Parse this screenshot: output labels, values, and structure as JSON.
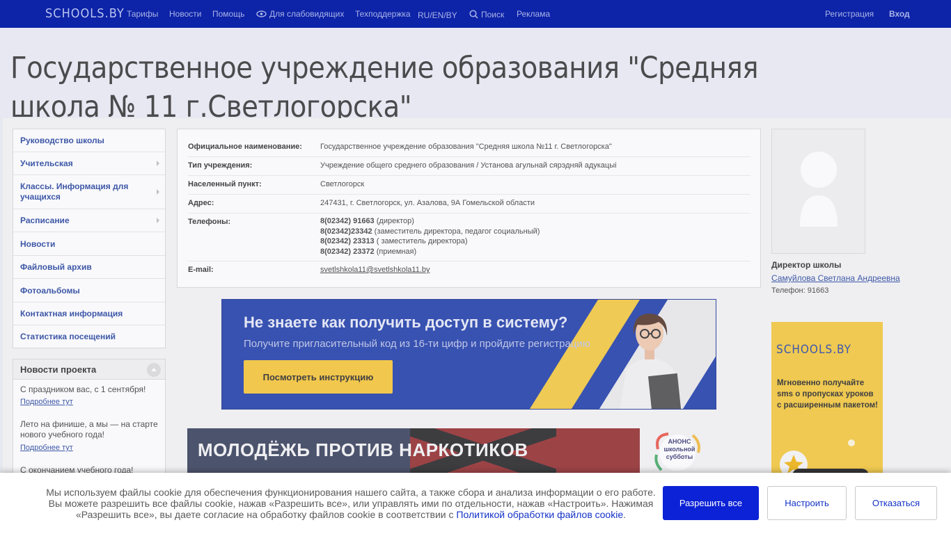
{
  "topnav": {
    "logo": "SCHOOLS.BY",
    "tariffs": "Тарифы",
    "news": "Новости",
    "help": "Помощь",
    "low_vision": "Для слабовидящих",
    "support": "Техподдержка",
    "lang": "RU/EN/BY",
    "search": "Поиск",
    "ads": "Реклама",
    "register": "Регистрация",
    "login": "Вход"
  },
  "header": {
    "title": "Государственное учреждение образования \"Средняя школа № 11 г.Светлогорска\""
  },
  "menu": {
    "items": [
      {
        "label": "Руководство школы"
      },
      {
        "label": "Учительская"
      },
      {
        "label": "Классы. Информация для учащихся"
      },
      {
        "label": "Расписание"
      },
      {
        "label": "Новости"
      },
      {
        "label": "Файловый архив"
      },
      {
        "label": "Фотоальбомы"
      },
      {
        "label": "Контактная информация"
      },
      {
        "label": "Статистика посещений"
      }
    ]
  },
  "project_news": {
    "title": "Новости проекта",
    "items": [
      {
        "text": "С праздником вас, с 1 сентября!",
        "link": "Подробнее тут"
      },
      {
        "text": "Лето на финише, а мы — на старте нового учебного года!",
        "link": "Подробнее тут"
      },
      {
        "text": "С окончанием учебного года!"
      }
    ]
  },
  "info": {
    "official_name_label": "Официальное наименование:",
    "official_name": "Государственное учреждение образования \"Средняя школа №11 г. Светлогорска\"",
    "type_label": "Тип учреждения:",
    "type": "Учреждение общего среднего образования / Установа агульнай сярэдняй адукацыі",
    "city_label": "Населенный пункт:",
    "city": "Светлогорск",
    "address_label": "Адрес:",
    "address": "247431, г. Светлогорск, ул. Азалова, 9А Гомельской области",
    "phones_label": "Телефоны:",
    "phones": [
      {
        "number": "8(02342) 91663",
        "note": " (директор)"
      },
      {
        "number": "8(02342)23342",
        "note": " (заместитель директора, педагог социальный)"
      },
      {
        "number": "8(02342) 23313",
        "note": " ( заместитель директора)"
      },
      {
        "number": "8(02342) 23372",
        "note": " (приемная)"
      }
    ],
    "email_label": "E-mail:",
    "email": "svetlshkola11@svetlshkola11.by"
  },
  "banner": {
    "heading": "Не знаете как получить доступ в систему?",
    "subheading": "Получите пригласительный код из 16-ти цифр и пройдите регистрацию",
    "button": "Посмотреть инструкцию"
  },
  "banner2": {
    "text": "МОЛОДЁЖЬ ПРОТИВ НАРКОТИКОВ",
    "anons": "АНОНС школьной субботы"
  },
  "director": {
    "title": "Директор школы",
    "name": "Самуйлова Светлана Андреевна",
    "phone": "Телефон: 91663"
  },
  "promo": {
    "logo": "SCHOOLS.BY",
    "text": "Мгновенно получайте sms о пропусках уроков с расширенным пакетом!"
  },
  "cookie": {
    "text_before": "Мы используем файлы cookie для обеспечения функционирования нашего сайта, а также сбора и анализа информации о его работе. Вы можете разрешить все файлы cookie, нажав «Разрешить все», или управлять ими по отдельности, нажав «Настроить». Нажимая «Разрешить все», вы даете согласие на обработку файлов cookie в соответствии с ",
    "link": "Политикой обработки файлов cookie",
    "text_after": ".",
    "allow_all": "Разрешить все",
    "configure": "Настроить",
    "decline": "Отказаться"
  }
}
